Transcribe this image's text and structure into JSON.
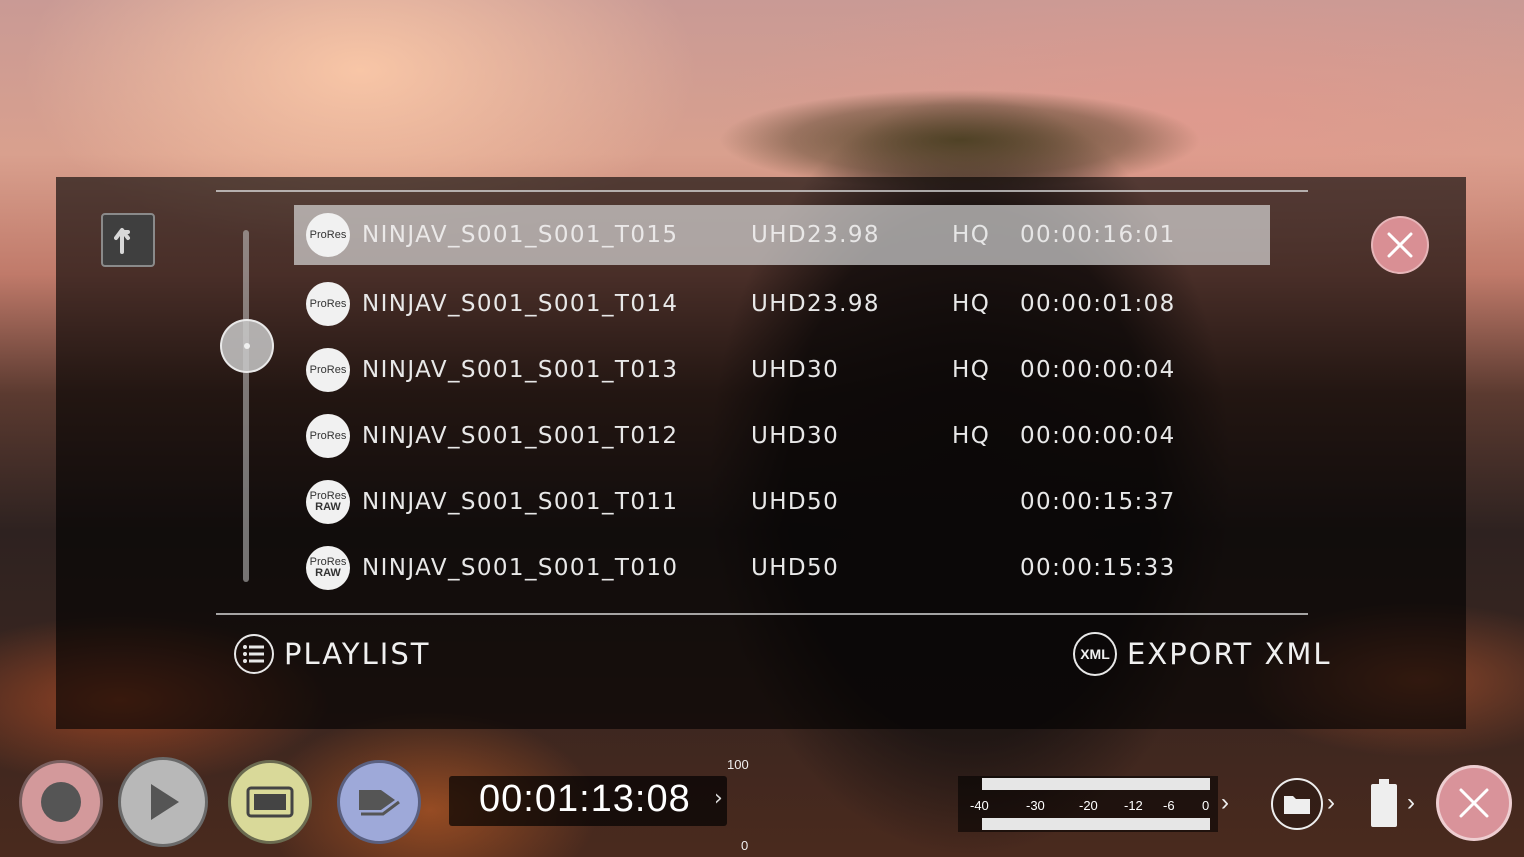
{
  "clips": [
    {
      "codec_top": "ProRes",
      "codec_bottom": "",
      "name": "NINJAV_S001_S001_T015",
      "resolution": "UHD23.98",
      "quality": "HQ",
      "duration": "00:00:16:01",
      "selected": true
    },
    {
      "codec_top": "ProRes",
      "codec_bottom": "",
      "name": "NINJAV_S001_S001_T014",
      "resolution": "UHD23.98",
      "quality": "HQ",
      "duration": "00:00:01:08",
      "selected": false
    },
    {
      "codec_top": "ProRes",
      "codec_bottom": "",
      "name": "NINJAV_S001_S001_T013",
      "resolution": "UHD30",
      "quality": "HQ",
      "duration": "00:00:00:04",
      "selected": false
    },
    {
      "codec_top": "ProRes",
      "codec_bottom": "",
      "name": "NINJAV_S001_S001_T012",
      "resolution": "UHD30",
      "quality": "HQ",
      "duration": "00:00:00:04",
      "selected": false
    },
    {
      "codec_top": "ProRes",
      "codec_bottom": "RAW",
      "name": "NINJAV_S001_S001_T011",
      "resolution": "UHD50",
      "quality": "",
      "duration": "00:00:15:37",
      "selected": false
    },
    {
      "codec_top": "ProRes",
      "codec_bottom": "RAW",
      "name": "NINJAV_S001_S001_T010",
      "resolution": "UHD50",
      "quality": "",
      "duration": "00:00:15:33",
      "selected": false
    }
  ],
  "scroll_position": 0.3,
  "actions": {
    "playlist_label": "PLAYLIST",
    "export_label": "EXPORT XML",
    "export_icon_text": "XML"
  },
  "transport": {
    "timecode": "00:01:13:08",
    "scale_top": "100",
    "scale_bottom": "0"
  },
  "audio_meter": {
    "ticks": [
      "-40",
      "-30",
      "-20",
      "-12",
      "-6",
      "0"
    ]
  },
  "icons": {
    "up": "up-arrow-icon",
    "close": "close-icon",
    "playlist": "list-icon",
    "export": "xml-icon",
    "record": "record-icon",
    "play": "play-icon",
    "monitor": "monitor-icon",
    "tag": "tag-icon",
    "media": "folder-icon",
    "battery": "battery-icon",
    "exit": "close-icon"
  },
  "colors": {
    "close_button": "#d98f94",
    "record_button": "#d3999b",
    "monitor_button": "#d9d999",
    "tag_button": "#9ea9d9",
    "selected_row": "#dcdcdc"
  }
}
